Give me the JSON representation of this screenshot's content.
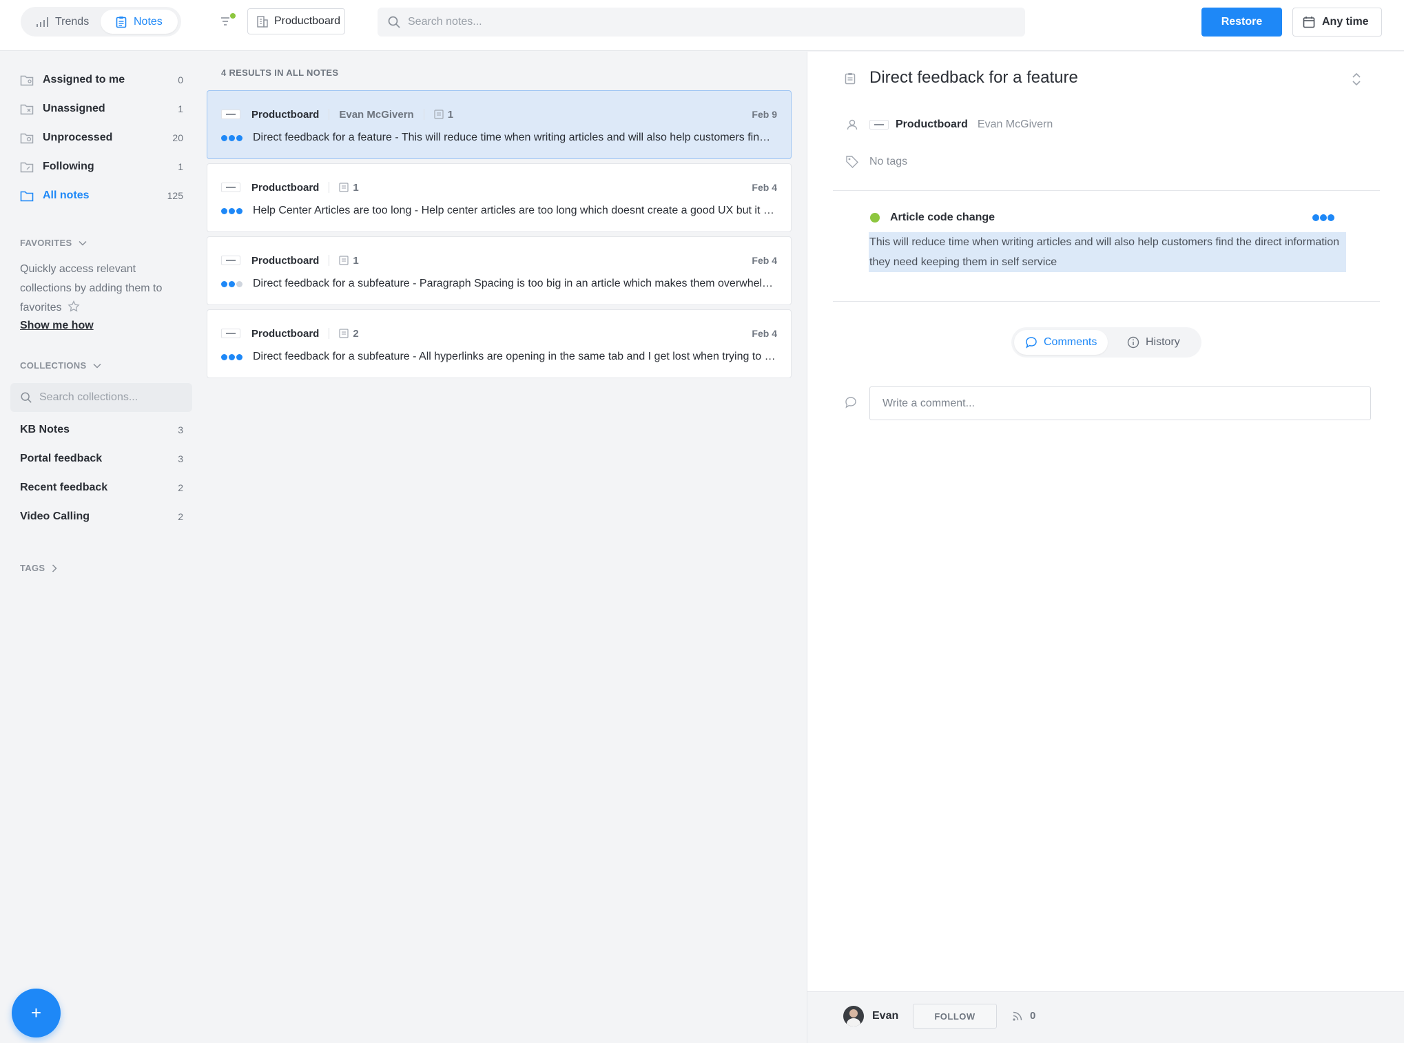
{
  "topbar": {
    "trends_label": "Trends",
    "notes_label": "Notes",
    "board_label": "Productboard",
    "search_placeholder": "Search notes...",
    "restore_label": "Restore",
    "anytime_label": "Any time"
  },
  "sidebar": {
    "nav": [
      {
        "label": "Assigned to me",
        "count": "0"
      },
      {
        "label": "Unassigned",
        "count": "1"
      },
      {
        "label": "Unprocessed",
        "count": "20"
      },
      {
        "label": "Following",
        "count": "1"
      },
      {
        "label": "All notes",
        "count": "125"
      }
    ],
    "favorites_heading": "FAVORITES",
    "favorites_text": "Quickly access relevant collections by adding them to favorites",
    "favorites_link": "Show me how",
    "collections_heading": "COLLECTIONS",
    "collections_search_placeholder": "Search collections...",
    "collections": [
      {
        "label": "KB Notes",
        "count": "3"
      },
      {
        "label": "Portal feedback",
        "count": "3"
      },
      {
        "label": "Recent feedback",
        "count": "2"
      },
      {
        "label": "Video Calling",
        "count": "2"
      }
    ],
    "tags_heading": "TAGS",
    "fab_label": "+"
  },
  "notes": {
    "results_heading": "4 RESULTS IN ALL NOTES",
    "items": [
      {
        "company": "Productboard",
        "author": "Evan McGivern",
        "insights": "1",
        "date": "Feb 9",
        "text": "Direct feedback for a feature - This will reduce time when writing articles and will also help customers find the direct information they need keeping them in self service",
        "importance": 3
      },
      {
        "company": "Productboard",
        "author": "",
        "insights": "1",
        "date": "Feb 4",
        "text": "Help Center Articles are too long - Help center articles are too long which doesnt create a good UX but it is important to keep everything",
        "importance": 3
      },
      {
        "company": "Productboard",
        "author": "",
        "insights": "1",
        "date": "Feb 4",
        "text": "Direct feedback for a subfeature - Paragraph Spacing is too big in an article which makes them overwhelming to read",
        "importance": 2
      },
      {
        "company": "Productboard",
        "author": "",
        "insights": "2",
        "date": "Feb 4",
        "text": "Direct feedback for a subfeature - All hyperlinks are opening in the same tab and I get lost when trying to go back",
        "importance": 3
      }
    ]
  },
  "detail": {
    "title": "Direct feedback for a feature",
    "company": "Productboard",
    "author": "Evan McGivern",
    "tags_text": "No tags",
    "insight_title": "Article code change",
    "insight_text": "This will reduce time when writing articles and will also help customers find the direct information they need keeping them in self service",
    "tab_comments": "Comments",
    "tab_history": "History",
    "comment_placeholder": "Write a comment...",
    "footer_name": "Evan",
    "follow_label": "FOLLOW",
    "followers_count": "0"
  },
  "colors": {
    "accent": "#1e88f7",
    "insight_status": "#8dc63f",
    "selected_card": "#dde9f8"
  }
}
